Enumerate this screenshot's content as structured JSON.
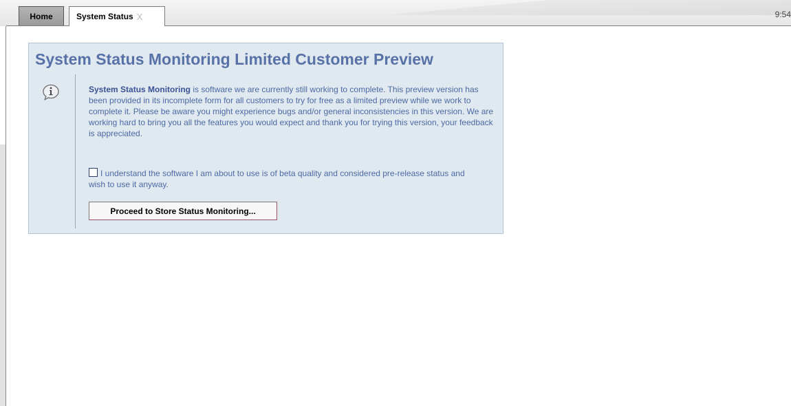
{
  "tabs": [
    {
      "label": "Home"
    },
    {
      "label": "System Status",
      "close": "X"
    }
  ],
  "clock": "9:54",
  "panel": {
    "title": "System Status Monitoring Limited Customer Preview",
    "intro_bold": "System Status Monitoring",
    "intro_rest": " is software we are currently still working to complete. This preview version has been provided in its incomplete form for all customers to try for free as a limited preview while we work to complete it. Please be aware you might experience bugs and/or general inconsistencies in this version. We are working hard to bring you all the features you would expect and thank you for trying this version, your feedback is appreciated.",
    "checkbox_label": "I understand the software I am about to use is of beta quality and considered pre-release status and wish to use it anyway.",
    "proceed_label": "Proceed to Store Status Monitoring...",
    "icon": "info-icon"
  }
}
